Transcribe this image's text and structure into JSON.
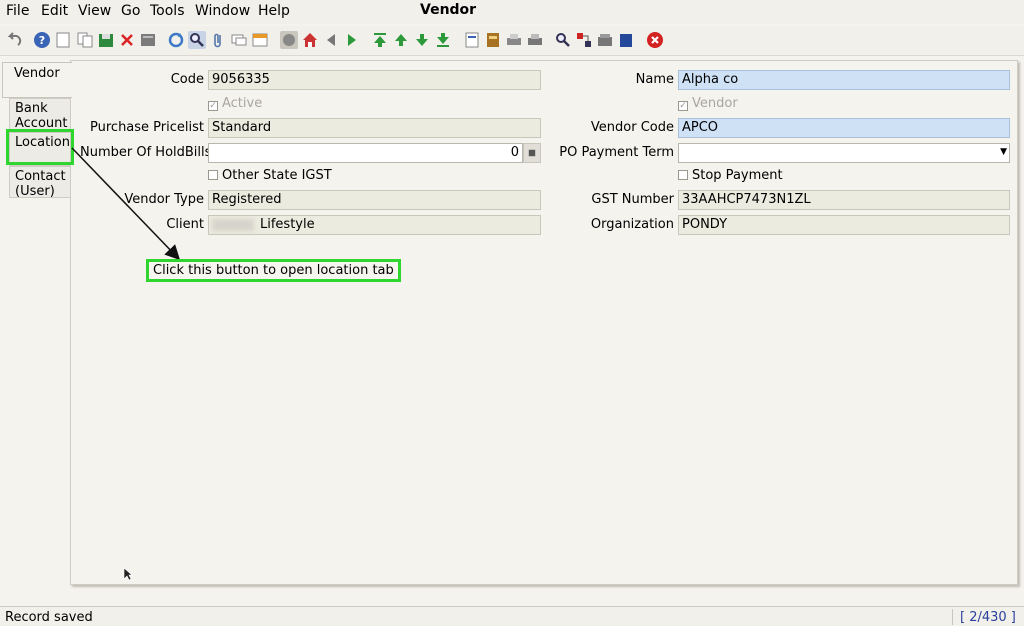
{
  "window": {
    "title": "Vendor"
  },
  "menu": [
    "File",
    "Edit",
    "View",
    "Go",
    "Tools",
    "Window",
    "Help"
  ],
  "toolbar_icons": [
    "undo-icon",
    "help-icon",
    "new-icon",
    "copy-icon",
    "save-icon",
    "delete-icon",
    "report-icon",
    "refresh-icon",
    "find-icon",
    "attachment-icon",
    "chat-icon",
    "history-icon",
    "zoom-icon",
    "home-icon",
    "back-icon",
    "forward-icon",
    "first-record-icon",
    "previous-record-icon",
    "next-record-icon",
    "last-record-icon",
    "archive-icon",
    "product-info-icon",
    "print-preview-icon",
    "print-icon",
    "zoom-across-icon",
    "workflow-icon",
    "request-icon",
    "lock-icon",
    "close-icon"
  ],
  "tabs": [
    "Vendor",
    "Bank Account",
    "Location",
    "Contact (User)"
  ],
  "form": {
    "code_label": "Code",
    "code_value": "9056335",
    "name_label": "Name",
    "name_value": "Alpha co",
    "active_label": "Active",
    "vendor_label": "Vendor",
    "purchase_pricelist_label": "Purchase Pricelist",
    "purchase_pricelist_value": "Standard",
    "vendor_code_label": "Vendor Code",
    "vendor_code_value": "APCO",
    "holdbills_label": "Number Of HoldBills",
    "holdbills_value": "0",
    "po_payment_term_label": "PO Payment Term",
    "po_payment_term_value": "",
    "other_state_igst_label": "Other State IGST",
    "stop_payment_label": "Stop Payment",
    "vendor_type_label": "Vendor Type",
    "vendor_type_value": "Registered",
    "gst_number_label": "GST Number",
    "gst_number_value": "33AAHCP7473N1ZL",
    "client_label": "Client",
    "client_value": "Lifestyle",
    "organization_label": "Organization",
    "organization_value": "PONDY"
  },
  "annotation": {
    "callout_text": "Click this button to open location tab"
  },
  "status": {
    "message": "Record saved",
    "record_count": "[ 2/430 ]"
  },
  "colors": {
    "highlight": "#2fd62f",
    "mandatory_field": "#cfe1f5",
    "readonly_field": "#ecebdf"
  }
}
